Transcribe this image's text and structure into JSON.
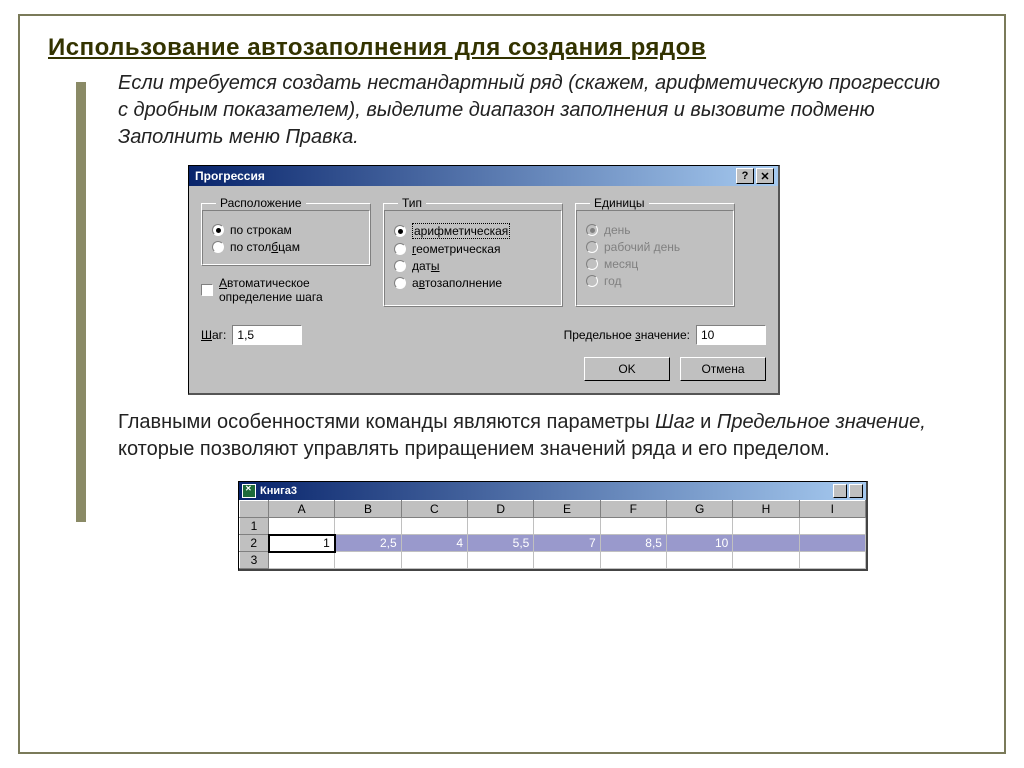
{
  "page": {
    "title": "Использование автозаполнения для создания рядов",
    "intro": "Если требуется создать нестандартный ряд (скажем, арифметическую прогрессию с дробным показателем), выделите диапазон заполнения и вызовите подменю Заполнить меню Правка.",
    "para2_prefix": "Главными особенностями команды являются параметры ",
    "para2_em1": "Шаг",
    "para2_mid": " и ",
    "para2_em2": "Предельное значение,",
    "para2_suffix": " которые позволяют управлять приращением значений ряда и его пределом."
  },
  "dialog": {
    "title": "Прогрессия",
    "help_btn": "?",
    "close_btn": "✕",
    "group_layout": "Расположение",
    "layout_rows": "по строкам",
    "layout_cols": "по столбцам",
    "auto_step_l1": "Автоматическое",
    "auto_step_l2": "определение шага",
    "group_type": "Тип",
    "type_arith": "арифметическая",
    "type_geom": "геометрическая",
    "type_dates": "даты",
    "type_autofill": "автозаполнение",
    "group_units": "Единицы",
    "unit_day": "день",
    "unit_work": "рабочий день",
    "unit_month": "месяц",
    "unit_year": "год",
    "step_label": "Шаг:",
    "step_value": "1,5",
    "limit_label": "Предельное значение:",
    "limit_value": "10",
    "ok": "OK",
    "cancel": "Отмена"
  },
  "sheet": {
    "title": "Книга3",
    "cols": [
      "A",
      "B",
      "C",
      "D",
      "E",
      "F",
      "G",
      "H",
      "I"
    ],
    "rows": [
      "1",
      "2",
      "3"
    ],
    "row2": [
      "1",
      "2,5",
      "4",
      "5,5",
      "7",
      "8,5",
      "10",
      "",
      ""
    ]
  }
}
